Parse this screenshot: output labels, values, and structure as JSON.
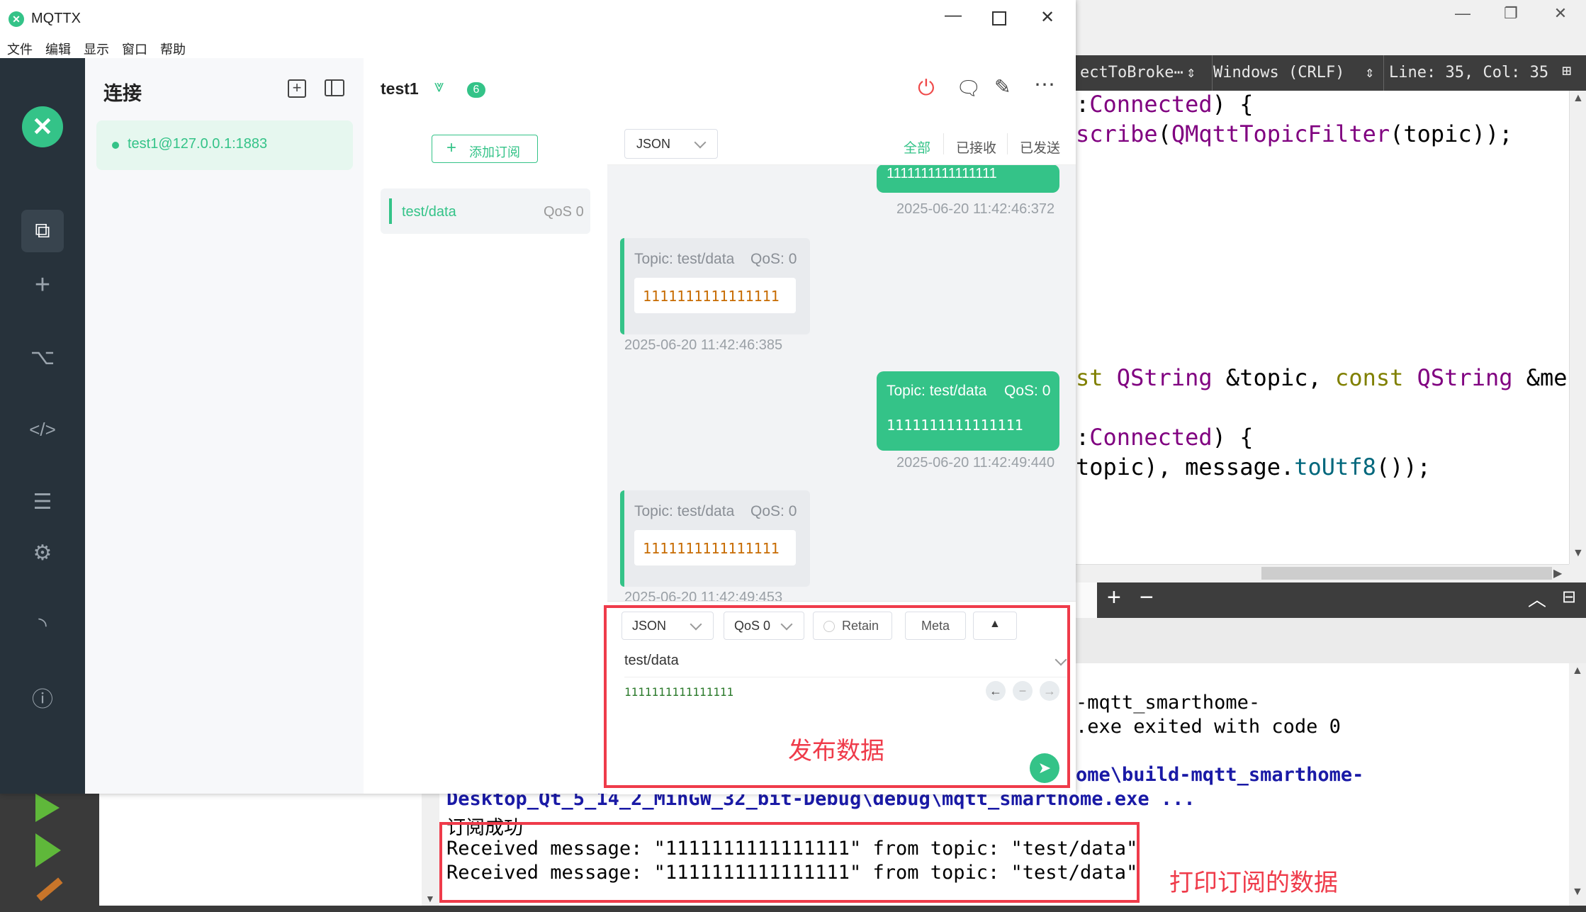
{
  "mqttx": {
    "window_title": "MQTTX",
    "menu": [
      "文件",
      "编辑",
      "显示",
      "窗口",
      "帮助"
    ],
    "connections_title": "连接",
    "connections": [
      {
        "name": "test1@127.0.0.1:1883",
        "status_color": "#34c388"
      }
    ],
    "active_connection": {
      "name": "test1",
      "badge_count": "6"
    },
    "add_subscription_label": "添加订阅",
    "subscriptions": [
      {
        "topic": "test/data",
        "qos": "QoS 0"
      }
    ],
    "message_filter": {
      "format": "JSON",
      "tabs": [
        "全部",
        "已接收",
        "已发送"
      ]
    },
    "messages": [
      {
        "direction": "out",
        "partial": true,
        "payload": "1111111111111111",
        "time": "2025-06-20 11:42:46:372"
      },
      {
        "direction": "in",
        "topic": "Topic: test/data",
        "qos": "QoS: 0",
        "payload": "1111111111111111",
        "time": "2025-06-20 11:42:46:385"
      },
      {
        "direction": "out",
        "topic": "Topic: test/data",
        "qos": "QoS: 0",
        "payload": "1111111111111111",
        "time": "2025-06-20 11:42:49:440"
      },
      {
        "direction": "in",
        "topic": "Topic: test/data",
        "qos": "QoS: 0",
        "payload": "1111111111111111",
        "time": "2025-06-20 11:42:49:453"
      }
    ],
    "publish": {
      "format": "JSON",
      "qos": "QoS 0",
      "retain_label": "Retain",
      "meta_label": "Meta",
      "topic": "test/data",
      "payload": "1111111111111111"
    },
    "accent_color": "#34c388"
  },
  "annotations": {
    "publish": "发布数据",
    "subscribe_print": "打印订阅的数据"
  },
  "qt": {
    "toolbar": {
      "function_combo": "ectToBroke⋯",
      "line_endings": "Windows (CRLF)",
      "position": "Line: 35, Col: 35"
    },
    "code_lines": [
      {
        "pre": ":",
        "purple": "Connected",
        "rest": ") {"
      },
      {
        "pre": "",
        "purple": "scribe",
        "rest": "(",
        "purple2": "QMqttTopicFilter",
        "rest2": "(topic));"
      },
      {
        "olive": "st",
        "rest": " ",
        "purple": "QString",
        "rest2": " &topic, ",
        "olive2": "const",
        "rest3": " ",
        "purple2": "QString",
        "rest4": " &mes"
      },
      {
        "pre": ":",
        "purple": "Connected",
        "rest": ") {"
      },
      {
        "pre": "topic), message.",
        "blue": "toUtf8",
        "rest": "());"
      }
    ],
    "output_lines": [
      {
        "text": "-mqtt_smarthome-",
        "style": "plain"
      },
      {
        "text": ".exe exited with code 0",
        "style": "plain"
      },
      {
        "text": "ome\\build-mqtt_smarthome-",
        "style": "blue"
      },
      {
        "text": "Desktop_Qt_5_14_2_MinGW_32_bit-Debug\\debug\\mqtt_smarthome.exe ...",
        "style": "blue"
      },
      {
        "text": "订阅成功",
        "style": "plain"
      },
      {
        "text": "Received message: \"1111111111111111\" from topic: \"test/data\"",
        "style": "plain"
      },
      {
        "text": "Received message: \"1111111111111111\" from topic: \"test/data\"",
        "style": "plain"
      }
    ]
  }
}
